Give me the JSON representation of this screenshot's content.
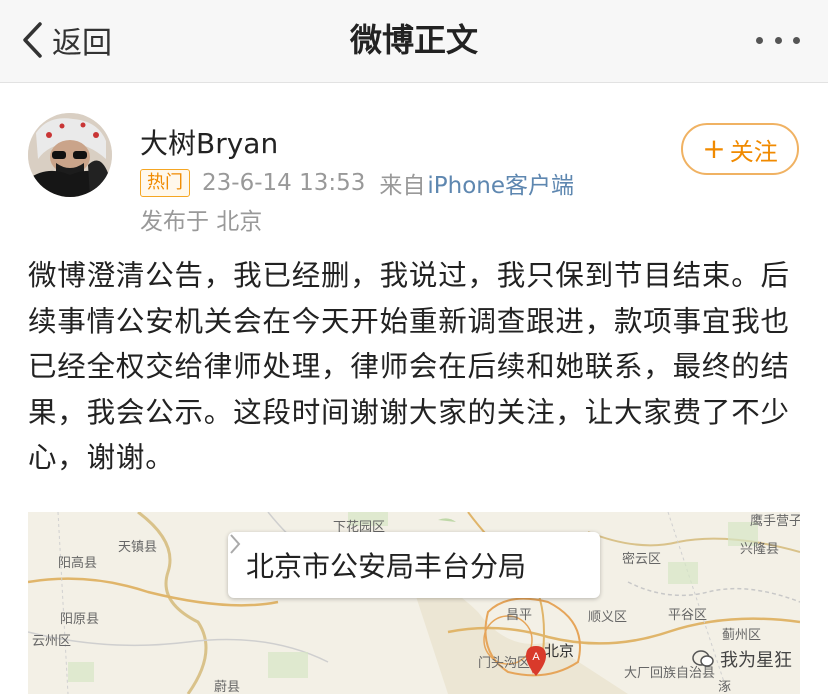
{
  "nav": {
    "back_label": "返回",
    "title": "微博正文"
  },
  "post": {
    "username": "大树Bryan",
    "badge": "热门",
    "time": "23-6-14 13:53",
    "source_prefix": "来自",
    "source": "iPhone客户端",
    "location": "发布于 北京",
    "follow_label": "关注",
    "text": "微博澄清公告，我已经删，我说过，我只保到节目结束。后续事情公安机关会在今天开始重新调查跟进，款项事宜我也已经全权交给律师处理，律师会在后续和她联系，最终的结果，我会公示。这段时间谢谢大家的关注，让大家费了不少心，谢谢。"
  },
  "map": {
    "place_name": "北京市公安局丰台分局",
    "labels": [
      "天镇县",
      "阳高县",
      "下花园区",
      "密云区",
      "兴隆县",
      "平谷区",
      "顺义区",
      "阳原县",
      "蔚县",
      "门头沟区",
      "北京",
      "大厂回族自治县",
      "蓟州区",
      "云州区",
      "涿",
      "昌平",
      "鹰手营子"
    ],
    "marker_label": "A"
  },
  "watermark": "我为星狂",
  "colors": {
    "accent": "#f08a00",
    "link": "#5e87b0",
    "follow_border": "#f0b263"
  }
}
